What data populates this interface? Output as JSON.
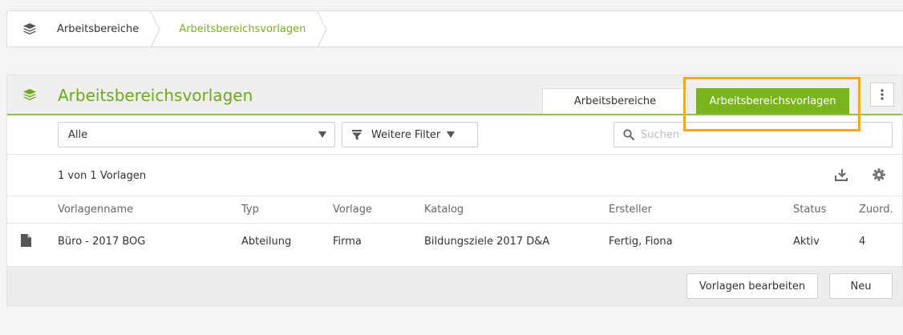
{
  "breadcrumb": {
    "items": [
      "Arbeitsbereiche",
      "Arbeitsbereichsvorlagen"
    ]
  },
  "panel": {
    "title": "Arbeitsbereichsvorlagen",
    "tabs": [
      "Arbeitsbereiche",
      "Arbeitsbereichsvorlagen"
    ],
    "active_tab": "Arbeitsbereichsvorlagen"
  },
  "filters": {
    "select_value": "Alle",
    "more_filter_label": "Weitere Filter",
    "search_placeholder": "Suchen"
  },
  "count_text": "1 von 1 Vorlagen",
  "table": {
    "columns": [
      "Vorlagenname",
      "Typ",
      "Vorlage",
      "Katalog",
      "Ersteller",
      "Status",
      "Zuord."
    ],
    "rows": [
      {
        "name": "Büro - 2017 BOG",
        "typ": "Abteilung",
        "vorlage": "Firma",
        "katalog": "Bildungsziele 2017 D&A",
        "ersteller": "Fertig, Fiona",
        "status": "Aktiv",
        "zuord": "4"
      }
    ]
  },
  "footer": {
    "edit_label": "Vorlagen bearbeiten",
    "new_label": "Neu"
  },
  "colors": {
    "accent_green": "#7ab41d",
    "title_green": "#6fa71f",
    "highlight": "#f5a623"
  },
  "icons": [
    "layers-icon",
    "filter-icon",
    "search-icon",
    "download-icon",
    "gear-icon",
    "document-icon",
    "kebab-menu-icon",
    "caret-down-icon"
  ]
}
